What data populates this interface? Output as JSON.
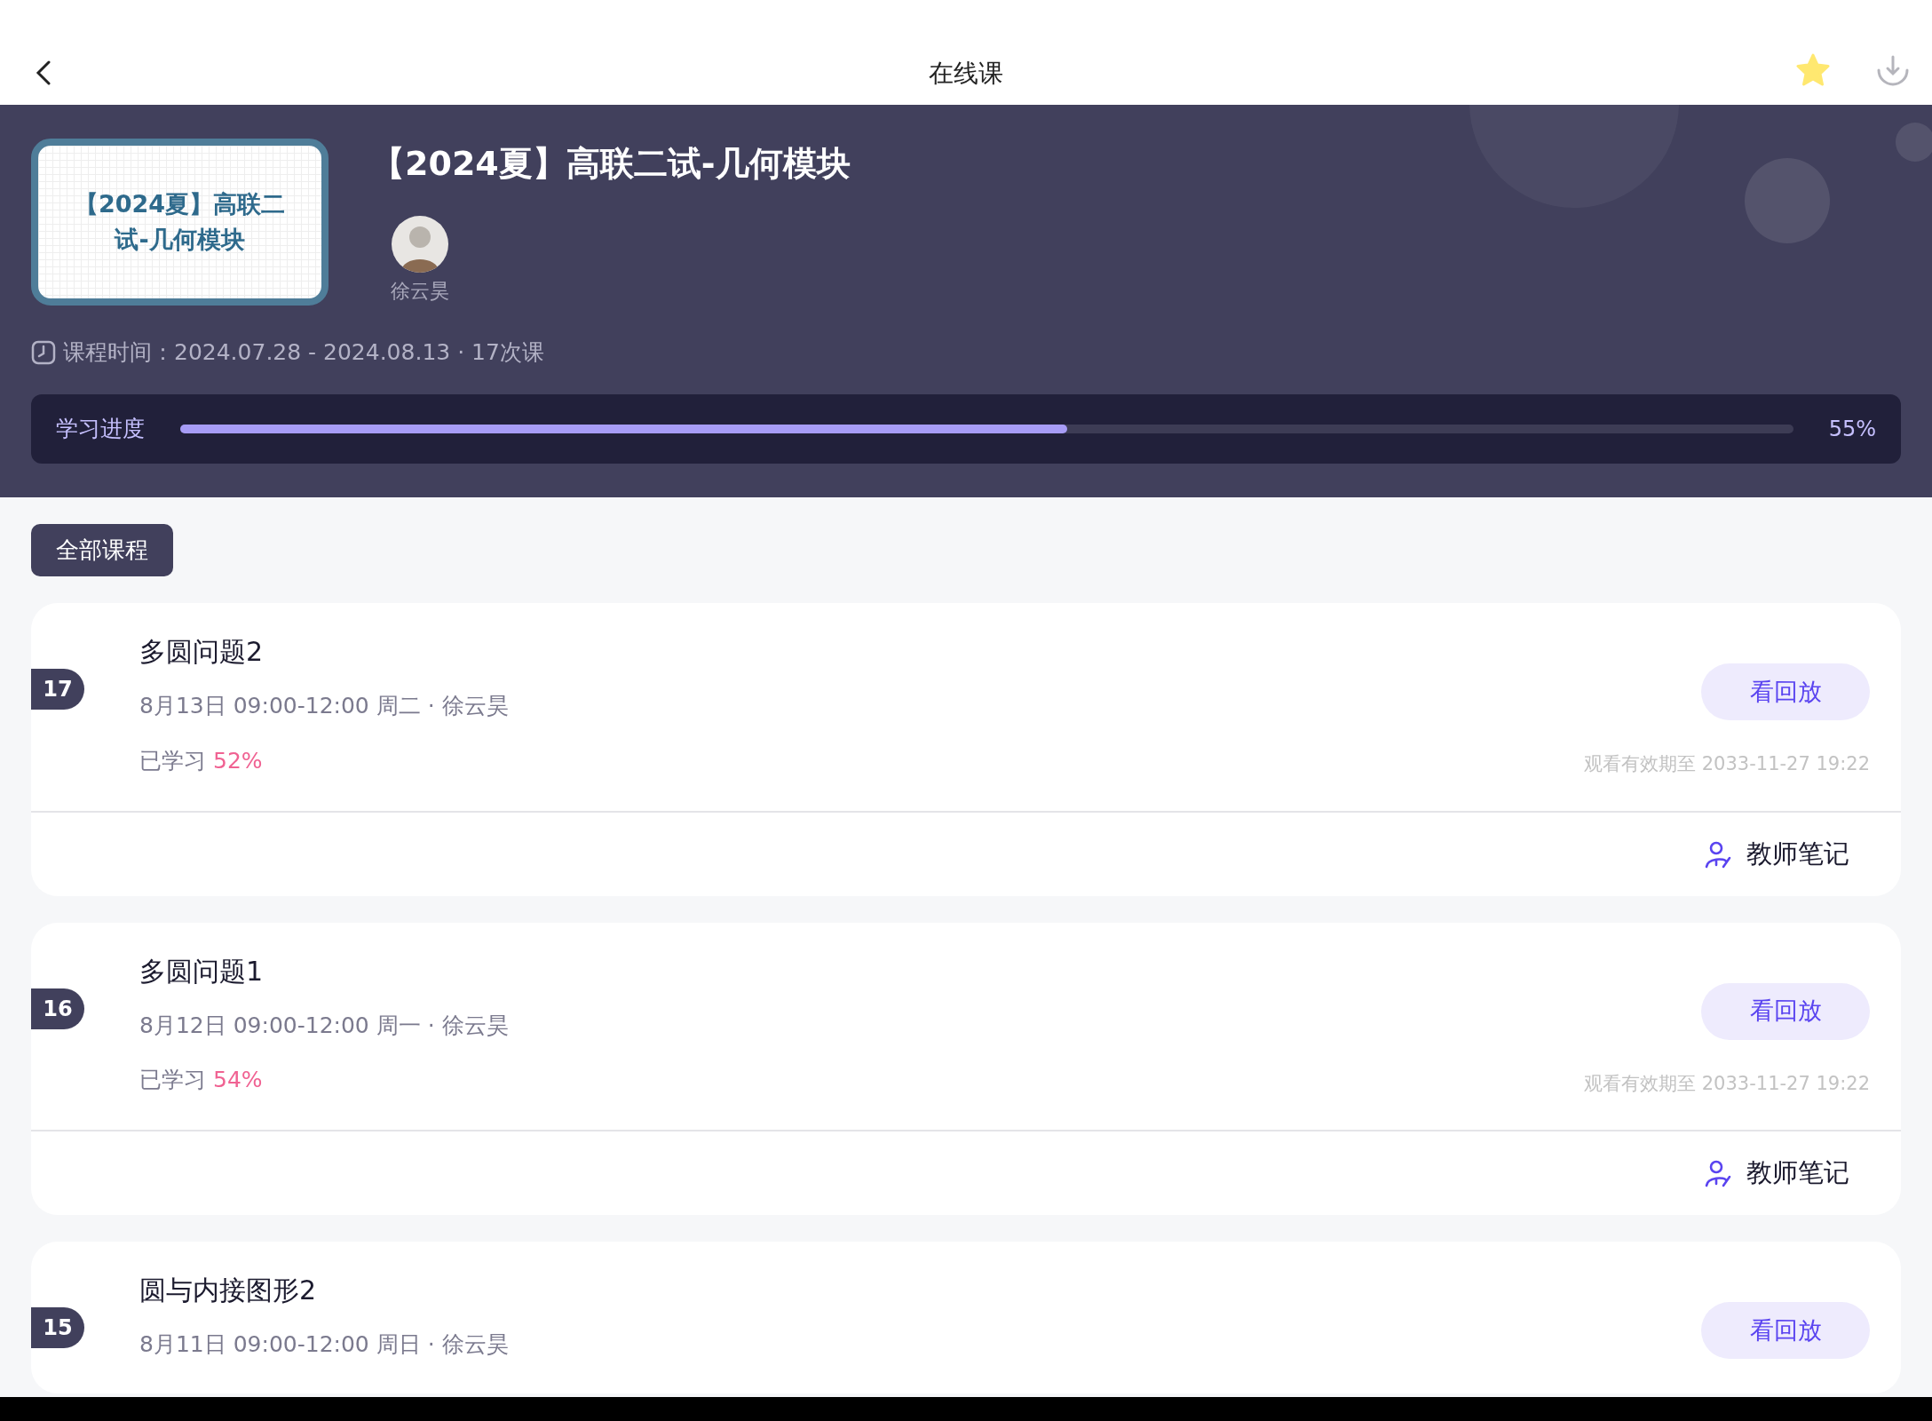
{
  "header": {
    "title": "在线课",
    "favorited": true
  },
  "course": {
    "thumbnail_lines": [
      "【2024夏】高联二",
      "试-几何模块"
    ],
    "title": "【2024夏】高联二试-几何模块",
    "teacher": "徐云昊",
    "time_text": "课程时间：2024.07.28 - 2024.08.13 · 17次课"
  },
  "progress": {
    "label": "学习进度",
    "level": 0.55,
    "reading": "55%"
  },
  "filter_tabs": [
    {
      "label": "全部课程",
      "selected": true
    }
  ],
  "lessons": [
    {
      "number": "17",
      "title": "多圆问题2",
      "schedule": "8月13日  09:00-12:00 周二 · 徐云昊",
      "studied_label": "已学习",
      "studied_value": "52%",
      "action": "看回放",
      "expiry": "观看有效期至 2033-11-27 19:22",
      "notes": "教师笔记"
    },
    {
      "number": "16",
      "title": "多圆问题1",
      "schedule": "8月12日  09:00-12:00 周一 · 徐云昊",
      "studied_label": "已学习",
      "studied_value": "54%",
      "action": "看回放",
      "expiry": "观看有效期至 2033-11-27 19:22",
      "notes": "教师笔记"
    },
    {
      "number": "15",
      "title": "圆与内接图形2",
      "schedule": "8月11日  09:00-12:00 周日 · 徐云昊",
      "action": "看回放"
    }
  ]
}
